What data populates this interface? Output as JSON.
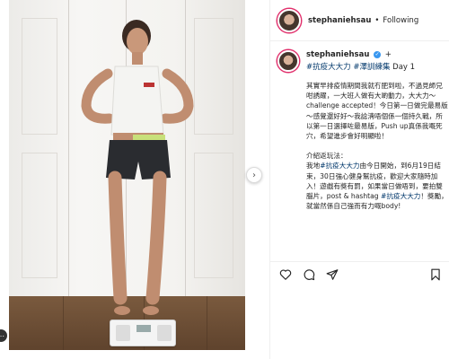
{
  "header": {
    "username": "stephaniehsau",
    "separator": "•",
    "follow_status": "Following"
  },
  "post": {
    "username": "stephaniehsau",
    "verified_glyph": "✓",
    "plus": "+",
    "tags": {
      "tag1": "#抗疫大大力",
      "tag2": "#澤訓練集",
      "day": "Day 1"
    },
    "caption": {
      "para1": "其實早排疫情期間我就冇肥到啦，不過見師兄咁誘躍，一大班人做有大啲動力，大大力～challenge accepted！今日第一日做完最易版～感覺還好好～我諗淸唔個係一個持久戰，所以第一日選擇咗最易版，Push up真係我嘅死穴，希望進步會好明顯啦！",
      "para2_intro": "介紹返玩法：",
      "para2_before": "我地",
      "para2_tag": "#抗疫大大力",
      "para2_after": "由今日開始，到6月19日結束，30日強心健身幫抗疫，歡迎大家隨時加入！遊戲有獎有罰，如果當日做唔到，要拍雙腦片，post & hashtag",
      "para2_tag2": "#抗疫大大力",
      "para2_end": "！獎勵，就當然係自己強而有力嘅body!"
    }
  },
  "icons": {
    "heart": "heart-icon",
    "comment": "comment-icon",
    "share": "share-icon",
    "bookmark": "bookmark-icon",
    "next": "chevron-right-icon"
  },
  "glyphs": {
    "next_arrow": "›"
  },
  "colors": {
    "story_ring": "#e1306c",
    "hashtag": "#00376b",
    "verified": "#3897f0"
  }
}
